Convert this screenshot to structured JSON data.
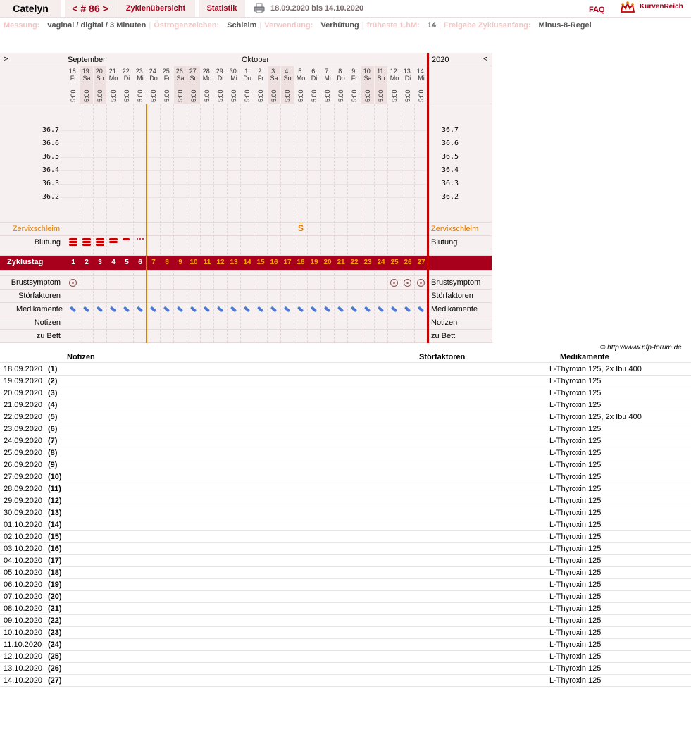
{
  "app": {
    "user": "Catelyn",
    "cycle_nav": "< # 86 >",
    "tabs": [
      "Zyklenübersicht",
      "Statistik"
    ],
    "date_range": "18.09.2020 bis 14.10.2020",
    "faq": "FAQ",
    "logo": "KurvenReich"
  },
  "info": [
    {
      "label": "Messung:",
      "value": "vaginal / digital / 3 Minuten"
    },
    {
      "label": "Östrogenzeichen:",
      "value": "Schleim"
    },
    {
      "label": "Verwendung:",
      "value": "Verhütung"
    },
    {
      "label": "früheste 1.hM:",
      "value": "14"
    },
    {
      "label": "Freigabe Zyklusanfang:",
      "value": "Minus-8-Regel"
    }
  ],
  "chart": {
    "nav_left": ">",
    "nav_right": "<",
    "month1": "September",
    "month2": "Oktober",
    "year": "2020",
    "time": "5:00",
    "days": [
      {
        "d": "18.",
        "w": "Fr"
      },
      {
        "d": "19.",
        "w": "Sa"
      },
      {
        "d": "20.",
        "w": "So"
      },
      {
        "d": "21.",
        "w": "Mo"
      },
      {
        "d": "22.",
        "w": "Di"
      },
      {
        "d": "23.",
        "w": "Mi"
      },
      {
        "d": "24.",
        "w": "Do"
      },
      {
        "d": "25.",
        "w": "Fr"
      },
      {
        "d": "26.",
        "w": "Sa"
      },
      {
        "d": "27.",
        "w": "So"
      },
      {
        "d": "28.",
        "w": "Mo"
      },
      {
        "d": "29.",
        "w": "Di"
      },
      {
        "d": "30.",
        "w": "Mi"
      },
      {
        "d": "1.",
        "w": "Do"
      },
      {
        "d": "2.",
        "w": "Fr"
      },
      {
        "d": "3.",
        "w": "Sa"
      },
      {
        "d": "4.",
        "w": "So"
      },
      {
        "d": "5.",
        "w": "Mo"
      },
      {
        "d": "6.",
        "w": "Di"
      },
      {
        "d": "7.",
        "w": "Mi"
      },
      {
        "d": "8.",
        "w": "Do"
      },
      {
        "d": "9.",
        "w": "Fr"
      },
      {
        "d": "10.",
        "w": "Sa"
      },
      {
        "d": "11.",
        "w": "So"
      },
      {
        "d": "12.",
        "w": "Mo"
      },
      {
        "d": "13.",
        "w": "Di"
      },
      {
        "d": "14.",
        "w": "Mi"
      }
    ],
    "temps": [
      "36.7",
      "36.6",
      "36.5",
      "36.4",
      "36.3",
      "36.2"
    ],
    "rows": {
      "zervix": "Zervixschleim",
      "blutung": "Blutung",
      "zyklustag": "Zyklustag",
      "brust": "Brustsymptom",
      "stoer": "Störfaktoren",
      "medi": "Medikamente",
      "notizen": "Notizen",
      "bett": "zu Bett"
    },
    "zervix_mark": "S",
    "zervix_mark_day": 18,
    "bleeding": [
      3,
      4,
      4,
      2,
      1,
      0.5
    ],
    "breast_days": [
      1,
      25,
      26,
      27
    ]
  },
  "notes": {
    "copyright": "© http://www.nfp-forum.de",
    "headers": {
      "notizen": "Notizen",
      "stoer": "Störfaktoren",
      "medi": "Medikamente"
    },
    "rows": [
      {
        "date": "18.09.2020",
        "day": "(1)",
        "med": "L-Thyroxin 125, 2x Ibu 400"
      },
      {
        "date": "19.09.2020",
        "day": "(2)",
        "med": "L-Thyroxin 125"
      },
      {
        "date": "20.09.2020",
        "day": "(3)",
        "med": "L-Thyroxin 125"
      },
      {
        "date": "21.09.2020",
        "day": "(4)",
        "med": "L-Thyroxin 125"
      },
      {
        "date": "22.09.2020",
        "day": "(5)",
        "med": "L-Thyroxin 125, 2x Ibu 400"
      },
      {
        "date": "23.09.2020",
        "day": "(6)",
        "med": "L-Thyroxin 125"
      },
      {
        "date": "24.09.2020",
        "day": "(7)",
        "med": "L-Thyroxin 125"
      },
      {
        "date": "25.09.2020",
        "day": "(8)",
        "med": "L-Thyroxin 125"
      },
      {
        "date": "26.09.2020",
        "day": "(9)",
        "med": "L-Thyroxin 125"
      },
      {
        "date": "27.09.2020",
        "day": "(10)",
        "med": "L-Thyroxin 125"
      },
      {
        "date": "28.09.2020",
        "day": "(11)",
        "med": "L-Thyroxin 125"
      },
      {
        "date": "29.09.2020",
        "day": "(12)",
        "med": "L-Thyroxin 125"
      },
      {
        "date": "30.09.2020",
        "day": "(13)",
        "med": "L-Thyroxin 125"
      },
      {
        "date": "01.10.2020",
        "day": "(14)",
        "med": "L-Thyroxin 125"
      },
      {
        "date": "02.10.2020",
        "day": "(15)",
        "med": "L-Thyroxin 125"
      },
      {
        "date": "03.10.2020",
        "day": "(16)",
        "med": "L-Thyroxin 125"
      },
      {
        "date": "04.10.2020",
        "day": "(17)",
        "med": "L-Thyroxin 125"
      },
      {
        "date": "05.10.2020",
        "day": "(18)",
        "med": "L-Thyroxin 125"
      },
      {
        "date": "06.10.2020",
        "day": "(19)",
        "med": "L-Thyroxin 125"
      },
      {
        "date": "07.10.2020",
        "day": "(20)",
        "med": "L-Thyroxin 125"
      },
      {
        "date": "08.10.2020",
        "day": "(21)",
        "med": "L-Thyroxin 125"
      },
      {
        "date": "09.10.2020",
        "day": "(22)",
        "med": "L-Thyroxin 125"
      },
      {
        "date": "10.10.2020",
        "day": "(23)",
        "med": "L-Thyroxin 125"
      },
      {
        "date": "11.10.2020",
        "day": "(24)",
        "med": "L-Thyroxin 125"
      },
      {
        "date": "12.10.2020",
        "day": "(25)",
        "med": "L-Thyroxin 125"
      },
      {
        "date": "13.10.2020",
        "day": "(26)",
        "med": "L-Thyroxin 125"
      },
      {
        "date": "14.10.2020",
        "day": "(27)",
        "med": "L-Thyroxin 125"
      }
    ]
  },
  "colors": {
    "accent": "#a8001c",
    "orange": "#e07b00",
    "pill": "#4d79d6"
  }
}
